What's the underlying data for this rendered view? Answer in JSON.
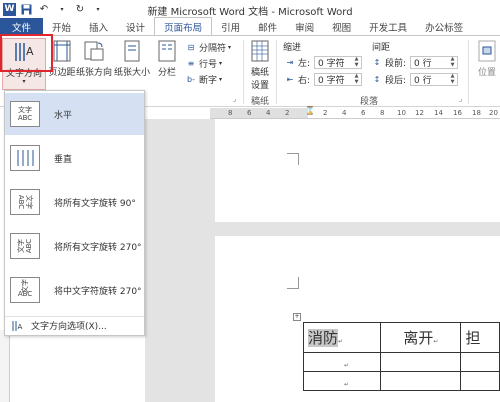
{
  "title": "新建 Microsoft Word 文档 - Microsoft Word",
  "tabs": [
    "文件",
    "开始",
    "插入",
    "设计",
    "页面布局",
    "引用",
    "邮件",
    "审阅",
    "视图",
    "开发工具",
    "办公标签"
  ],
  "ribbon": {
    "text_direction": "文字方向",
    "margins": "页边距",
    "orientation": "纸张方向",
    "size": "纸张大小",
    "columns": "分栏",
    "breaks": "分隔符",
    "line_numbers": "行号",
    "hyphenation": "断字",
    "manuscript_line1": "稿纸",
    "manuscript_line2": "设置",
    "manuscript_group": "稿纸",
    "indent_header": "缩进",
    "spacing_header": "间距",
    "indent_left_label": "左:",
    "indent_left_value": "0 字符",
    "indent_right_label": "右:",
    "indent_right_value": "0 字符",
    "spacing_before_label": "段前:",
    "spacing_before_value": "0 行",
    "spacing_after_label": "段后:",
    "spacing_after_value": "0 行",
    "paragraph_group": "段落",
    "position": "位置"
  },
  "ruler_ticks": [
    "8",
    "6",
    "4",
    "2",
    "2",
    "4",
    "6",
    "8",
    "10",
    "12",
    "14",
    "16",
    "18",
    "20"
  ],
  "dropdown": {
    "items": [
      {
        "label": "水平",
        "icon_text": "文字ABC",
        "name": "horizontal-icon"
      },
      {
        "label": "垂直",
        "icon_text": "",
        "name": "vertical-icon"
      },
      {
        "label": "将所有文字旋转 90°",
        "icon_text": "文字ABC",
        "name": "rotate-90-icon"
      },
      {
        "label": "将所有文字旋转 270°",
        "icon_text": "文字ABC",
        "name": "rotate-270-icon"
      },
      {
        "label": "将中文字符旋转 270°",
        "icon_text": "文字ABC",
        "name": "rotate-cjk-270-icon"
      }
    ],
    "footer": "文字方向选项(X)..."
  },
  "table": {
    "row1": [
      "消防",
      "离开",
      "担"
    ],
    "cell_mark": "↵"
  },
  "colors": {
    "accent": "#2b579a",
    "highlight_red": "#e0262c",
    "menu_hover": "#d5e1f2"
  }
}
